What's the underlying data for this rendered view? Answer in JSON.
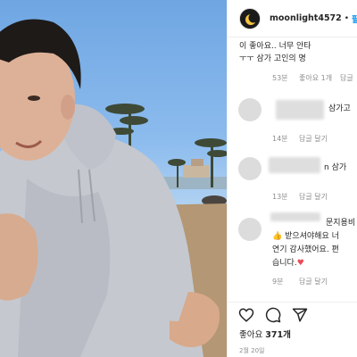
{
  "post": {
    "username": "moonlight4572",
    "separator": "•",
    "follow_label": "팔로"
  },
  "comments": [
    {
      "text_lines": [
        "이 좋아요.. 너무 안타",
        "ㅜㅜ 삼가 고인의 명"
      ],
      "time": "53분",
      "likes": "좋아요 1개",
      "reply": "답글"
    },
    {
      "text_lines": [
        "삼가고"
      ],
      "time": "14분",
      "likes": "",
      "reply": "답글 달기"
    },
    {
      "text_lines": [
        "n 삼가"
      ],
      "time": "13분",
      "likes": "",
      "reply": "답글 달기"
    },
    {
      "text_lines": [
        "문지용비",
        "👍 받으셔야해요 너",
        "연기 감사했어요. 편",
        "습니다."
      ],
      "time": "9분",
      "likes": "",
      "reply": "답글 달기"
    }
  ],
  "actions": {
    "like_icon": "heart-icon",
    "comment_icon": "comment-icon",
    "share_icon": "share-icon"
  },
  "likes_label": "좋아요",
  "likes_count": "371개",
  "date": "2월 20일"
}
